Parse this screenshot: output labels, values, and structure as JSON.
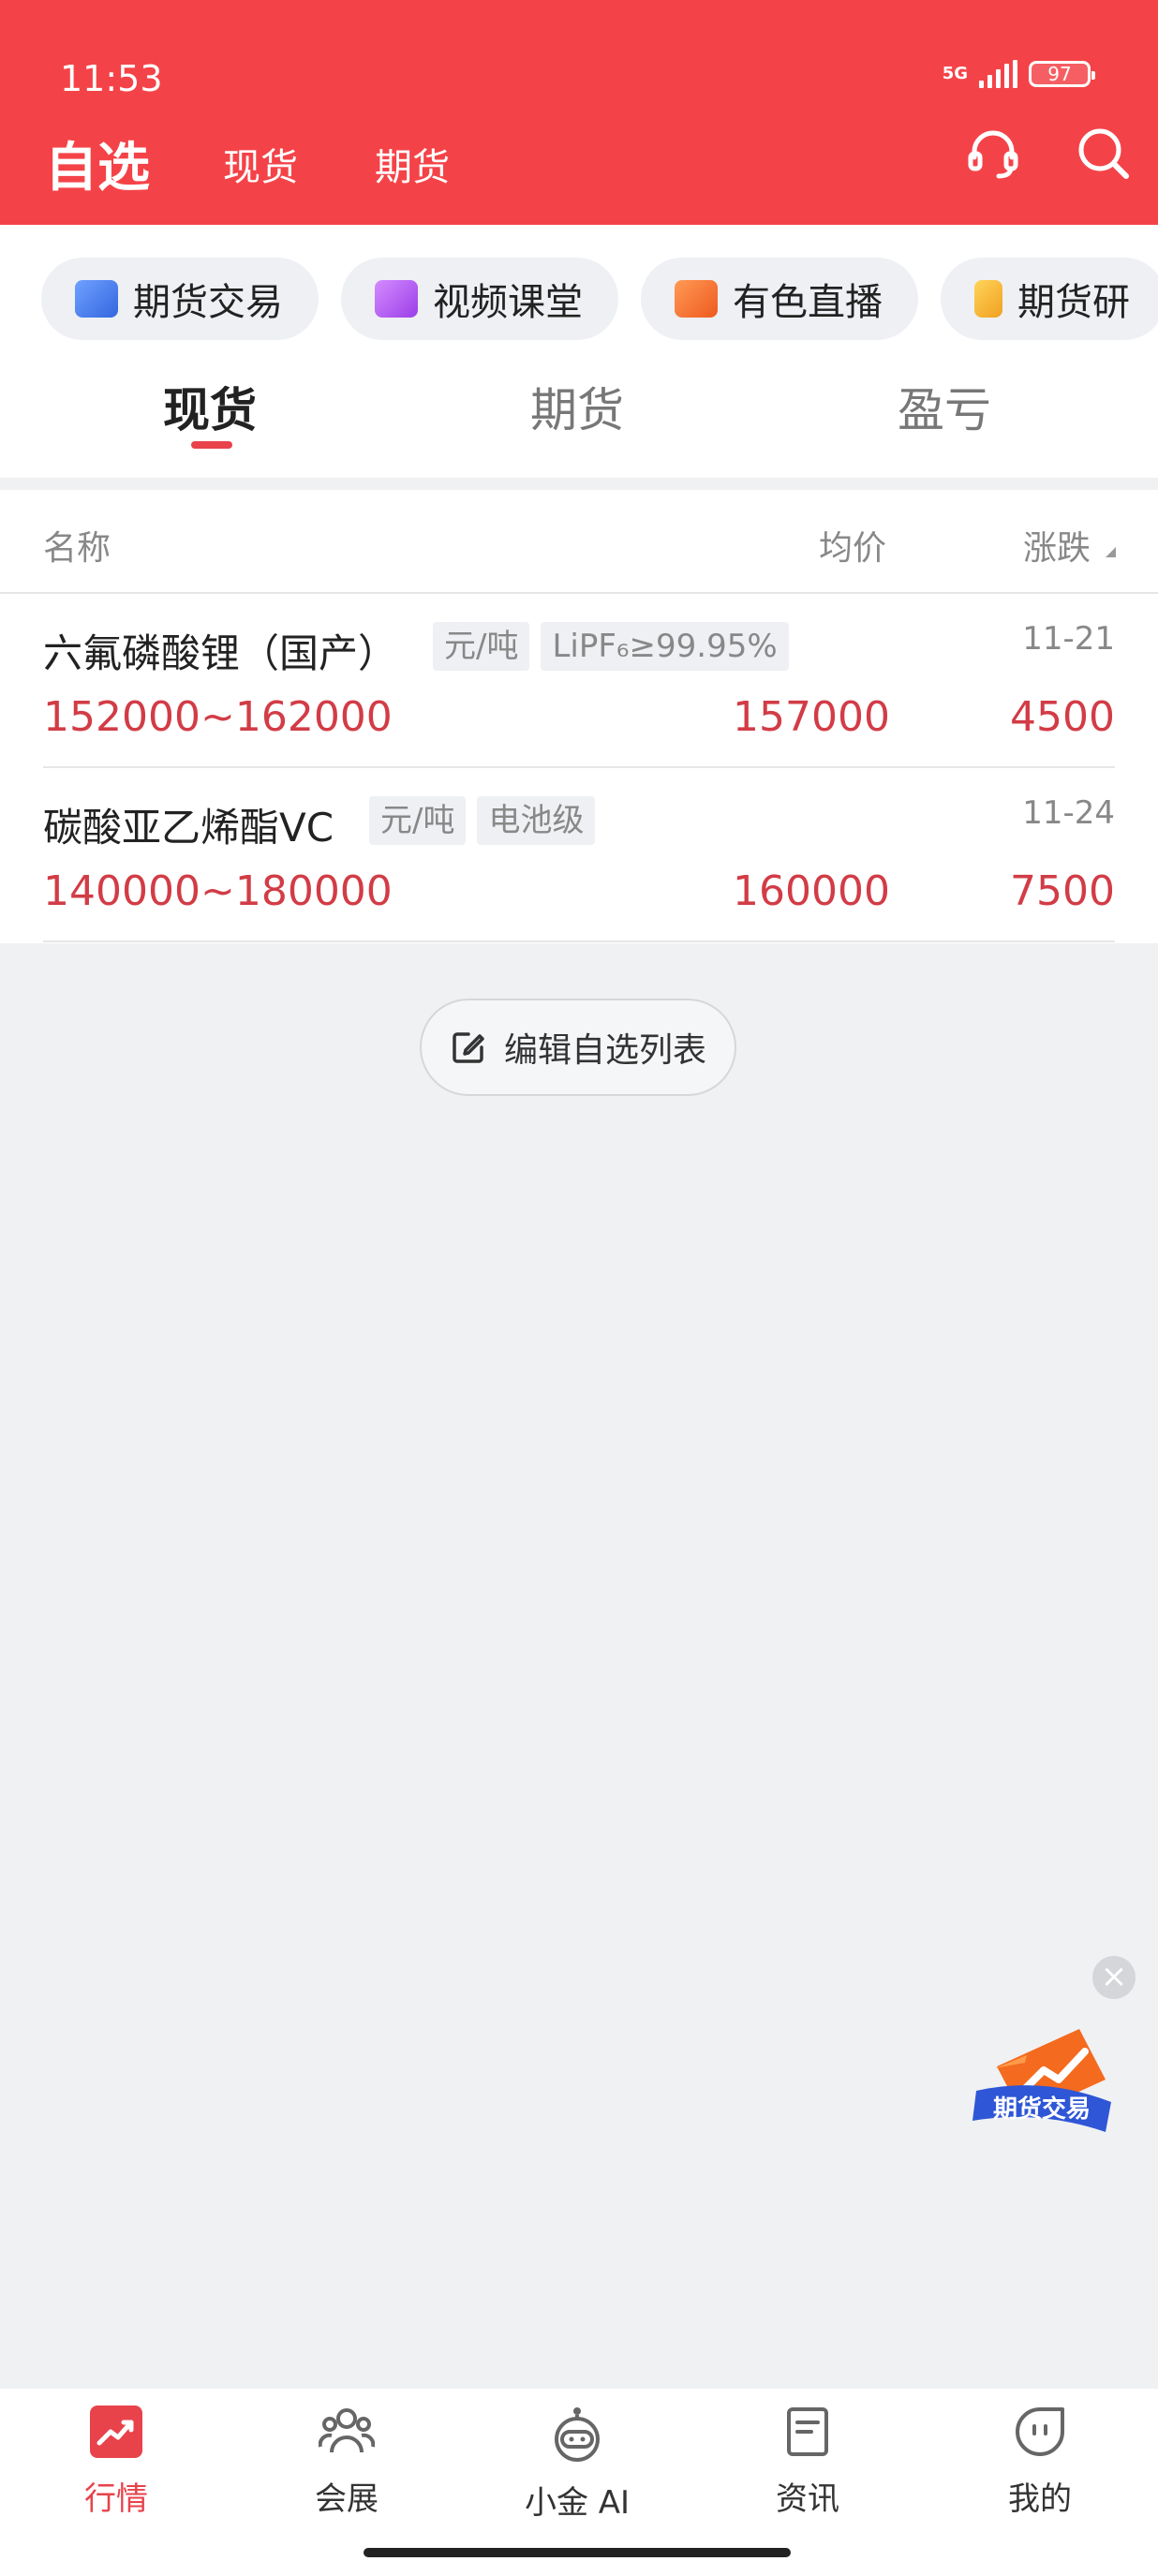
{
  "status_bar": {
    "time": "11:53",
    "network": "5G",
    "battery": "97"
  },
  "header": {
    "title": "自选",
    "tabs": [
      {
        "label": "现货"
      },
      {
        "label": "期货"
      }
    ],
    "icons": [
      "headset-icon",
      "search-icon"
    ]
  },
  "quick_links": [
    {
      "label": "期货交易",
      "icon": "trader-icon",
      "color": "#4f7df0"
    },
    {
      "label": "视频课堂",
      "icon": "video-icon",
      "color": "#b65cf0"
    },
    {
      "label": "有色直播",
      "icon": "live-camera-icon",
      "color": "#f06a2a"
    },
    {
      "label": "期货研",
      "icon": "research-icon",
      "color": "#f0b02a"
    }
  ],
  "sub_tabs": [
    {
      "label": "现货",
      "active": true
    },
    {
      "label": "期货",
      "active": false
    },
    {
      "label": "盈亏",
      "active": false
    }
  ],
  "table": {
    "headers": {
      "name": "名称",
      "avg": "均价",
      "change": "涨跌"
    },
    "rows": [
      {
        "name": "六氟磷酸锂（国产）",
        "tags": [
          "元/吨",
          "LiPF₆≥99.95%"
        ],
        "date": "11-21",
        "range": "152000~162000",
        "avg": "157000",
        "change": "4500"
      },
      {
        "name": "碳酸亚乙烯酯VC",
        "tags": [
          "元/吨",
          "电池级"
        ],
        "date": "11-24",
        "range": "140000~180000",
        "avg": "160000",
        "change": "7500"
      }
    ]
  },
  "edit_button": {
    "label": "编辑自选列表"
  },
  "float_ad": {
    "label": "期货交易"
  },
  "bottom_nav": [
    {
      "label": "行情",
      "icon": "market-icon",
      "active": true
    },
    {
      "label": "会展",
      "icon": "people-icon",
      "active": false
    },
    {
      "label": "小金 AI",
      "icon": "robot-icon",
      "active": false
    },
    {
      "label": "资讯",
      "icon": "news-icon",
      "active": false
    },
    {
      "label": "我的",
      "icon": "profile-icon",
      "active": false
    }
  ],
  "colors": {
    "brand_red": "#f44348",
    "price_red": "#d23c46",
    "active_tab_red": "#e8424a"
  }
}
